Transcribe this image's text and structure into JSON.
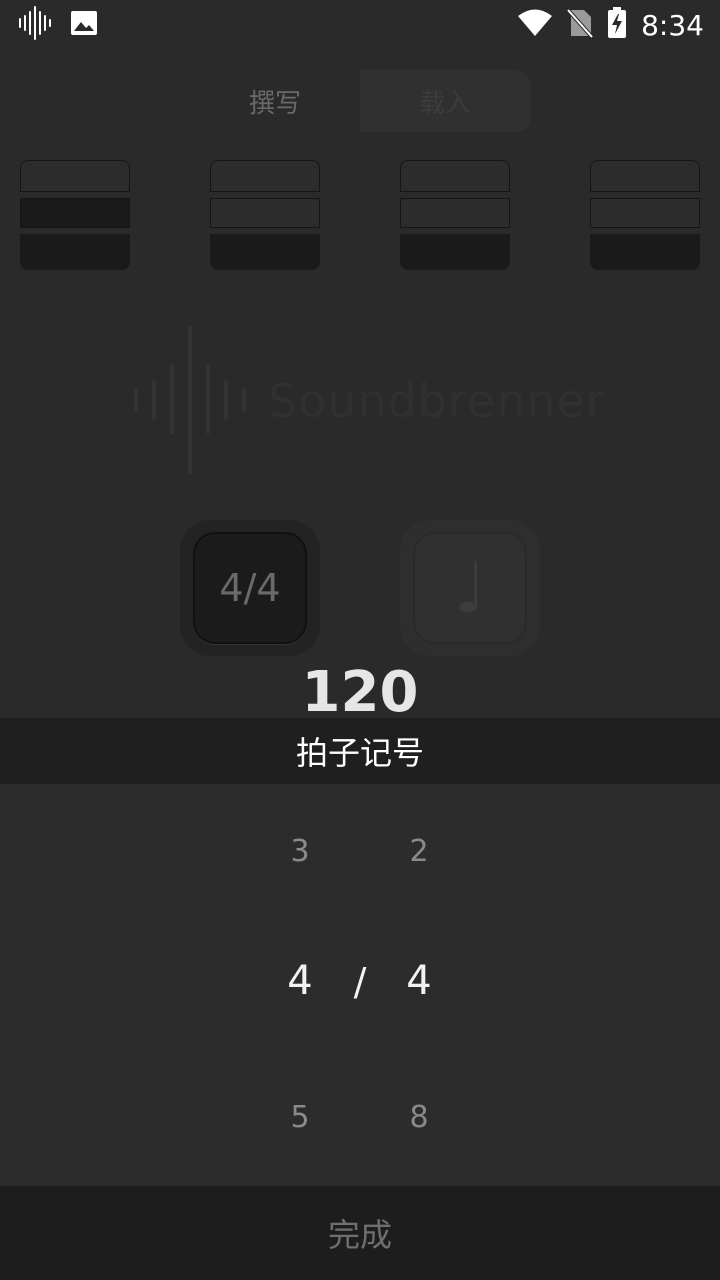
{
  "status_bar": {
    "time": "8:34",
    "left_icons": [
      "soundwave-icon",
      "image-icon"
    ],
    "right_icons": [
      "wifi-icon",
      "no-sim-icon",
      "battery-charging-icon"
    ]
  },
  "segmented": {
    "compose_label": "撰写",
    "load_label": "载入"
  },
  "beats": [
    {
      "accent": "strong"
    },
    {
      "accent": "normal"
    },
    {
      "accent": "normal"
    },
    {
      "accent": "normal"
    }
  ],
  "logo": {
    "wordmark": "Soundbrenner"
  },
  "controls": {
    "time_signature": "4/4",
    "note_symbol": "♩",
    "bpm": "120"
  },
  "picker": {
    "title": "拍子记号",
    "numerator": {
      "above": "3",
      "selected": "4",
      "below": "5"
    },
    "separator": "/",
    "denominator": {
      "above": "2",
      "selected": "4",
      "below": "8"
    }
  },
  "done_label": "完成",
  "colors": {
    "background": "#2a2a2a",
    "picker_header": "#1f1f1f",
    "done_bar": "#1d1d1d"
  }
}
